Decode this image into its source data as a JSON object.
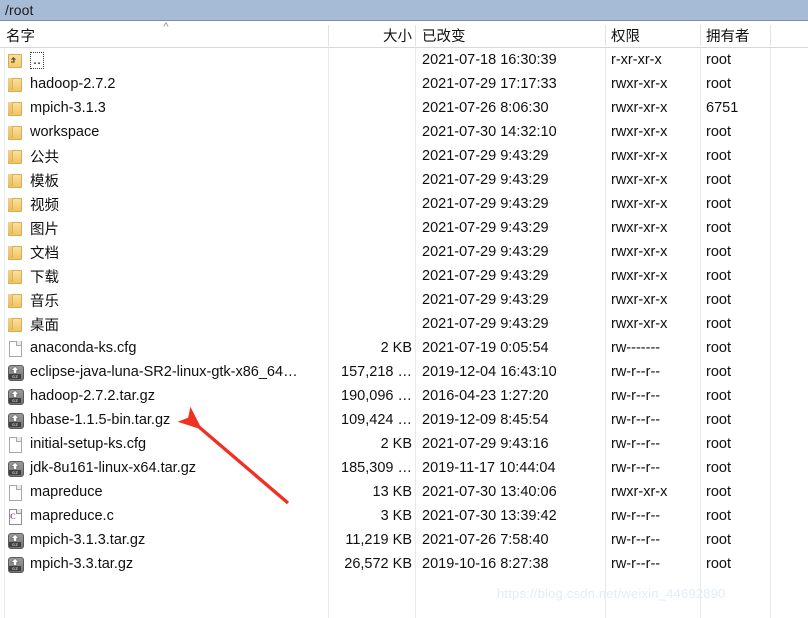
{
  "window": {
    "path": "/root"
  },
  "columns": [
    {
      "key": "name",
      "label": "名字",
      "align": "left"
    },
    {
      "key": "size",
      "label": "大小",
      "align": "right"
    },
    {
      "key": "mod",
      "label": "已改变",
      "align": "left"
    },
    {
      "key": "perm",
      "label": "权限",
      "align": "left"
    },
    {
      "key": "owner",
      "label": "拥有者",
      "align": "left"
    }
  ],
  "sort": {
    "column": "name",
    "direction": "ascending",
    "glyph": "^"
  },
  "rows": [
    {
      "icon": "folder-up-icon",
      "name": "..",
      "focused": true,
      "size": "",
      "mod": "2021-07-18 16:30:39",
      "perm": "r-xr-xr-x",
      "owner": "root"
    },
    {
      "icon": "folder-icon",
      "name": "hadoop-2.7.2",
      "focused": false,
      "size": "",
      "mod": "2021-07-29 17:17:33",
      "perm": "rwxr-xr-x",
      "owner": "root"
    },
    {
      "icon": "folder-icon",
      "name": "mpich-3.1.3",
      "focused": false,
      "size": "",
      "mod": "2021-07-26 8:06:30",
      "perm": "rwxr-xr-x",
      "owner": "6751"
    },
    {
      "icon": "folder-icon",
      "name": "workspace",
      "focused": false,
      "size": "",
      "mod": "2021-07-30 14:32:10",
      "perm": "rwxr-xr-x",
      "owner": "root"
    },
    {
      "icon": "folder-icon",
      "name": "公共",
      "focused": false,
      "size": "",
      "mod": "2021-07-29 9:43:29",
      "perm": "rwxr-xr-x",
      "owner": "root"
    },
    {
      "icon": "folder-icon",
      "name": "模板",
      "focused": false,
      "size": "",
      "mod": "2021-07-29 9:43:29",
      "perm": "rwxr-xr-x",
      "owner": "root"
    },
    {
      "icon": "folder-icon",
      "name": "视频",
      "focused": false,
      "size": "",
      "mod": "2021-07-29 9:43:29",
      "perm": "rwxr-xr-x",
      "owner": "root"
    },
    {
      "icon": "folder-icon",
      "name": "图片",
      "focused": false,
      "size": "",
      "mod": "2021-07-29 9:43:29",
      "perm": "rwxr-xr-x",
      "owner": "root"
    },
    {
      "icon": "folder-icon",
      "name": "文档",
      "focused": false,
      "size": "",
      "mod": "2021-07-29 9:43:29",
      "perm": "rwxr-xr-x",
      "owner": "root"
    },
    {
      "icon": "folder-icon",
      "name": "下载",
      "focused": false,
      "size": "",
      "mod": "2021-07-29 9:43:29",
      "perm": "rwxr-xr-x",
      "owner": "root"
    },
    {
      "icon": "folder-icon",
      "name": "音乐",
      "focused": false,
      "size": "",
      "mod": "2021-07-29 9:43:29",
      "perm": "rwxr-xr-x",
      "owner": "root"
    },
    {
      "icon": "folder-icon",
      "name": "桌面",
      "focused": false,
      "size": "",
      "mod": "2021-07-29 9:43:29",
      "perm": "rwxr-xr-x",
      "owner": "root"
    },
    {
      "icon": "document-icon",
      "name": "anaconda-ks.cfg",
      "focused": false,
      "size": "2 KB",
      "mod": "2021-07-19 0:05:54",
      "perm": "rw-------",
      "owner": "root"
    },
    {
      "icon": "gzip-icon",
      "name": "eclipse-java-luna-SR2-linux-gtk-x86_64…",
      "focused": false,
      "size": "157,218 …",
      "mod": "2019-12-04 16:43:10",
      "perm": "rw-r--r--",
      "owner": "root"
    },
    {
      "icon": "gzip-icon",
      "name": "hadoop-2.7.2.tar.gz",
      "focused": false,
      "size": "190,096 …",
      "mod": "2016-04-23 1:27:20",
      "perm": "rw-r--r--",
      "owner": "root"
    },
    {
      "icon": "gzip-icon",
      "name": "hbase-1.1.5-bin.tar.gz",
      "focused": false,
      "size": "109,424 …",
      "mod": "2019-12-09 8:45:54",
      "perm": "rw-r--r--",
      "owner": "root"
    },
    {
      "icon": "document-icon",
      "name": "initial-setup-ks.cfg",
      "focused": false,
      "size": "2 KB",
      "mod": "2021-07-29 9:43:16",
      "perm": "rw-r--r--",
      "owner": "root"
    },
    {
      "icon": "gzip-icon",
      "name": "jdk-8u161-linux-x64.tar.gz",
      "focused": false,
      "size": "185,309 …",
      "mod": "2019-11-17 10:44:04",
      "perm": "rw-r--r--",
      "owner": "root"
    },
    {
      "icon": "document-icon",
      "name": "mapreduce",
      "focused": false,
      "size": "13 KB",
      "mod": "2021-07-30 13:40:06",
      "perm": "rwxr-xr-x",
      "owner": "root"
    },
    {
      "icon": "c-source-icon",
      "name": "mapreduce.c",
      "focused": false,
      "size": "3 KB",
      "mod": "2021-07-30 13:39:42",
      "perm": "rw-r--r--",
      "owner": "root"
    },
    {
      "icon": "gzip-icon",
      "name": "mpich-3.1.3.tar.gz",
      "focused": false,
      "size": "11,219 KB",
      "mod": "2021-07-26 7:58:40",
      "perm": "rw-r--r--",
      "owner": "root"
    },
    {
      "icon": "gzip-icon",
      "name": "mpich-3.3.tar.gz",
      "focused": false,
      "size": "26,572 KB",
      "mod": "2019-10-16 8:27:38",
      "perm": "rw-r--r--",
      "owner": "root"
    }
  ],
  "annotation": {
    "type": "arrow",
    "color": "#ef3124",
    "points_to_row": "hbase-1.1.5-bin.tar.gz"
  },
  "watermark": {
    "text": "https://blog.csdn.net/weixin_44692890",
    "color": "#e3ecf6"
  },
  "colors": {
    "titlebar": "#a6bbd6",
    "grid_line": "#e6eaf0",
    "text": "#101010"
  }
}
